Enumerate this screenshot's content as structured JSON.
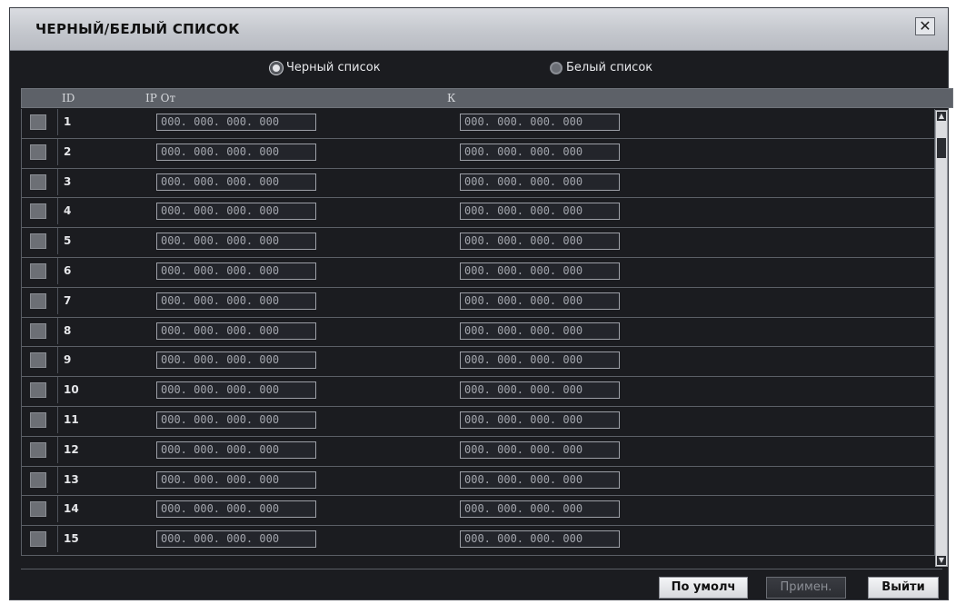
{
  "window": {
    "title": "ЧЕРНЫЙ/БЕЛЫЙ СПИСОК",
    "close_icon": "close-icon"
  },
  "radios": [
    {
      "label": "Черный список",
      "selected": true
    },
    {
      "label": "Белый список",
      "selected": false
    }
  ],
  "table": {
    "headers": {
      "id": "ID",
      "ip_from": "IP От",
      "ip_to": "К"
    },
    "rows": [
      {
        "id": "1",
        "from": "000. 000. 000. 000",
        "to": "000. 000. 000. 000"
      },
      {
        "id": "2",
        "from": "000. 000. 000. 000",
        "to": "000. 000. 000. 000"
      },
      {
        "id": "3",
        "from": "000. 000. 000. 000",
        "to": "000. 000. 000. 000"
      },
      {
        "id": "4",
        "from": "000. 000. 000. 000",
        "to": "000. 000. 000. 000"
      },
      {
        "id": "5",
        "from": "000. 000. 000. 000",
        "to": "000. 000. 000. 000"
      },
      {
        "id": "6",
        "from": "000. 000. 000. 000",
        "to": "000. 000. 000. 000"
      },
      {
        "id": "7",
        "from": "000. 000. 000. 000",
        "to": "000. 000. 000. 000"
      },
      {
        "id": "8",
        "from": "000. 000. 000. 000",
        "to": "000. 000. 000. 000"
      },
      {
        "id": "9",
        "from": "000. 000. 000. 000",
        "to": "000. 000. 000. 000"
      },
      {
        "id": "10",
        "from": "000. 000. 000. 000",
        "to": "000. 000. 000. 000"
      },
      {
        "id": "11",
        "from": "000. 000. 000. 000",
        "to": "000. 000. 000. 000"
      },
      {
        "id": "12",
        "from": "000. 000. 000. 000",
        "to": "000. 000. 000. 000"
      },
      {
        "id": "13",
        "from": "000. 000. 000. 000",
        "to": "000. 000. 000. 000"
      },
      {
        "id": "14",
        "from": "000. 000. 000. 000",
        "to": "000. 000. 000. 000"
      },
      {
        "id": "15",
        "from": "000. 000. 000. 000",
        "to": "000. 000. 000. 000"
      }
    ]
  },
  "buttons": {
    "default": "По умолч",
    "apply": "Примен.",
    "exit": "Выйти"
  }
}
